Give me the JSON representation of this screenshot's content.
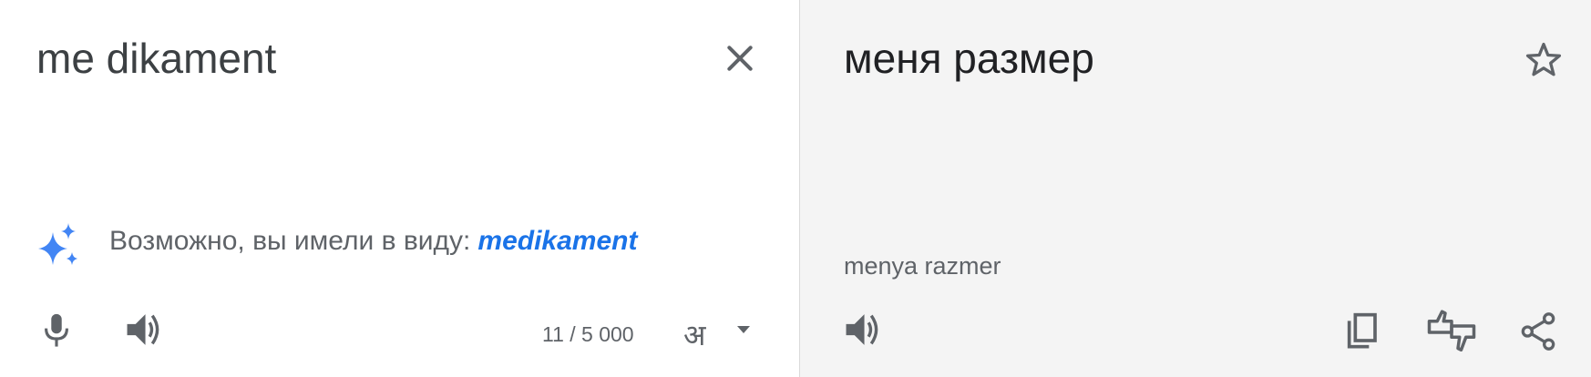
{
  "source": {
    "text": "me dikament",
    "suggestion_prefix": "Возможно, вы имели в виду:",
    "suggestion_word": "medikament",
    "char_count": "11 / 5 000",
    "ime_label": "अ"
  },
  "target": {
    "text": "меня размер",
    "transliteration": "menya razmer"
  },
  "icons": {
    "clear": "close-icon",
    "suggest": "sparkle-icon",
    "mic": "mic-icon",
    "listen": "speaker-icon",
    "ime": "ime-icon",
    "star": "star-icon",
    "copy": "copy-icon",
    "feedback": "feedback-icon",
    "share": "share-icon"
  },
  "colors": {
    "accent": "#1a73e8",
    "sparkle": "#4285f4",
    "icon": "#5f6368",
    "target_bg": "#f4f4f4"
  }
}
